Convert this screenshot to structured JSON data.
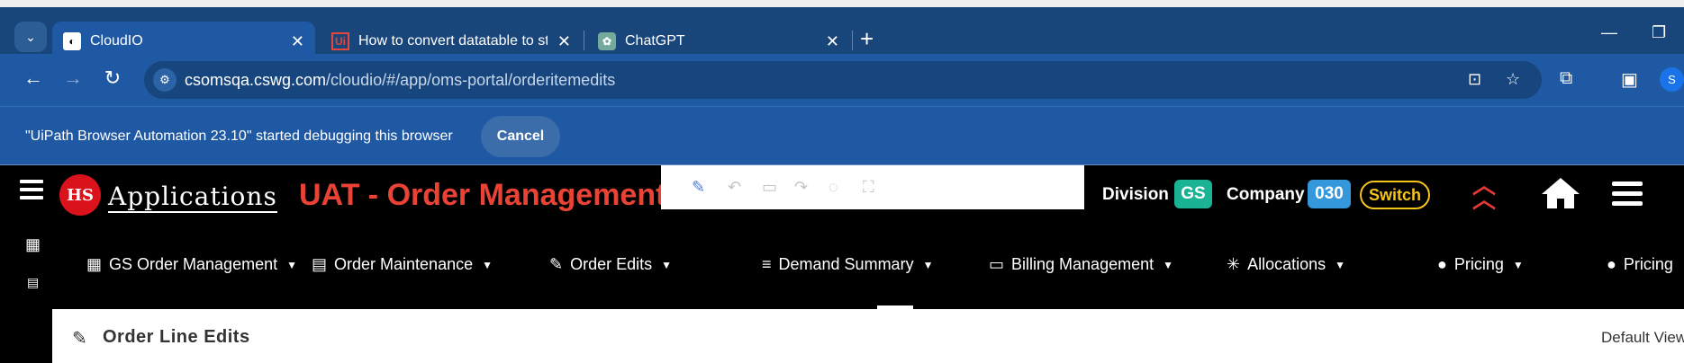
{
  "browser": {
    "tabs": [
      {
        "title": "CloudIO",
        "favicon": "cloudio-icon",
        "active": true
      },
      {
        "title": "How to convert datatable to stri",
        "favicon": "uipath-icon",
        "active": false
      },
      {
        "title": "ChatGPT",
        "favicon": "chatgpt-icon",
        "active": false
      }
    ],
    "url_host": "csomsqa.cswg.com",
    "url_path": "/cloudio/#/app/oms-portal/orderitemedits",
    "profile_initial": "S",
    "infobar_message": "\"UiPath Browser Automation 23.10\" started debugging this browser",
    "infobar_cancel": "Cancel"
  },
  "app": {
    "logo_text": "Applications",
    "logo_mark": "HS",
    "title": "UAT - Order Management",
    "division_label": "Division",
    "division_value": "GS",
    "company_label": "Company",
    "company_value": "030",
    "switch_label": "Switch",
    "menu": [
      {
        "label": "GS Order Management",
        "icon": "grid-icon"
      },
      {
        "label": "Order Maintenance",
        "icon": "id-card-icon"
      },
      {
        "label": "Order Edits",
        "icon": "edit-icon"
      },
      {
        "label": "Demand Summary",
        "icon": "list-icon"
      },
      {
        "label": "Billing Management",
        "icon": "billing-icon"
      },
      {
        "label": "Allocations",
        "icon": "asterisk-icon"
      },
      {
        "label": "Pricing",
        "icon": "dollar-icon"
      },
      {
        "label": "Pricing",
        "icon": "dollar-icon"
      }
    ],
    "page_title": "Order Line Edits",
    "view_label": "Default View"
  },
  "colors": {
    "tabstrip": "#18457a",
    "toolbar": "#1f58a3",
    "app_bg": "#000000",
    "title_red": "#ea4335",
    "division_badge": "#1ab394",
    "company_badge": "#3498db",
    "switch": "#f5c518"
  }
}
